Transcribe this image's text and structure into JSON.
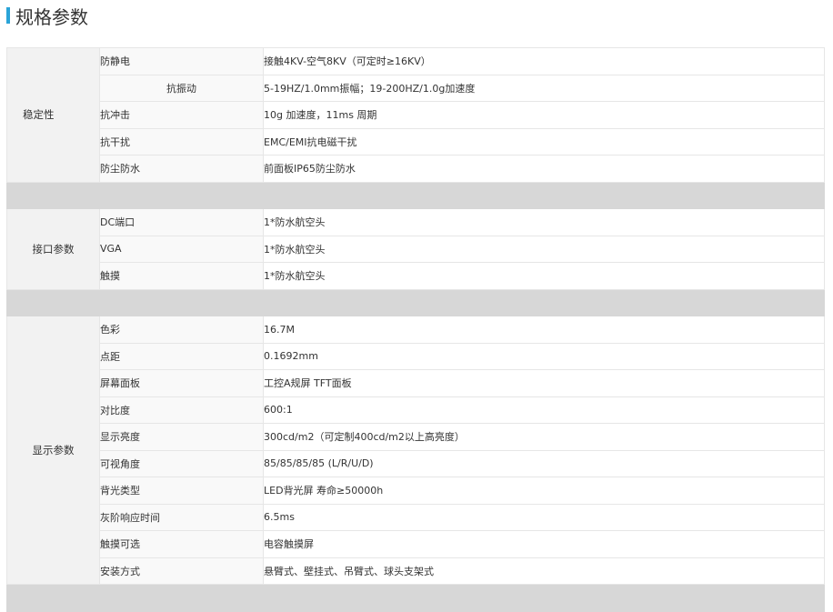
{
  "section_title": "规格参数",
  "groups": [
    {
      "label": "稳定性",
      "rows": [
        {
          "name": "防静电",
          "value": "接触4KV-空气8KV（可定时≥16KV）"
        },
        {
          "name": "抗振动",
          "value": "5-19HZ/1.0mm振幅；19-200HZ/1.0g加速度"
        },
        {
          "name": "抗冲击",
          "value": "10g 加速度，11ms 周期"
        },
        {
          "name": "抗干扰",
          "value": "EMC/EMI抗电磁干扰"
        },
        {
          "name": "防尘防水",
          "value": "前面板IP65防尘防水"
        }
      ]
    },
    {
      "label": "接口参数",
      "rows": [
        {
          "name": "DC端口",
          "value": "1*防水航空头"
        },
        {
          "name": "VGA",
          "value": "1*防水航空头"
        },
        {
          "name": "触摸",
          "value": "1*防水航空头"
        }
      ]
    },
    {
      "label": "显示参数",
      "rows": [
        {
          "name": "色彩",
          "value": "16.7M"
        },
        {
          "name": "点距",
          "value": "0.1692mm"
        },
        {
          "name": "屏幕面板",
          "value": "工控A规屏 TFT面板"
        },
        {
          "name": "对比度",
          "value": "600:1"
        },
        {
          "name": "显示亮度",
          "value": "300cd/m2（可定制400cd/m2以上高亮度）"
        },
        {
          "name": "可视角度",
          "value": "85/85/85/85 (L/R/U/D)"
        },
        {
          "name": "背光类型",
          "value": "LED背光屏 寿命≥50000h"
        },
        {
          "name": "灰阶响应时间",
          "value": "6.5ms"
        },
        {
          "name": "触摸可选",
          "value": "电容触摸屏"
        },
        {
          "name": "安装方式",
          "value": "悬臂式、壁挂式、吊臂式、球头支架式"
        }
      ]
    }
  ]
}
